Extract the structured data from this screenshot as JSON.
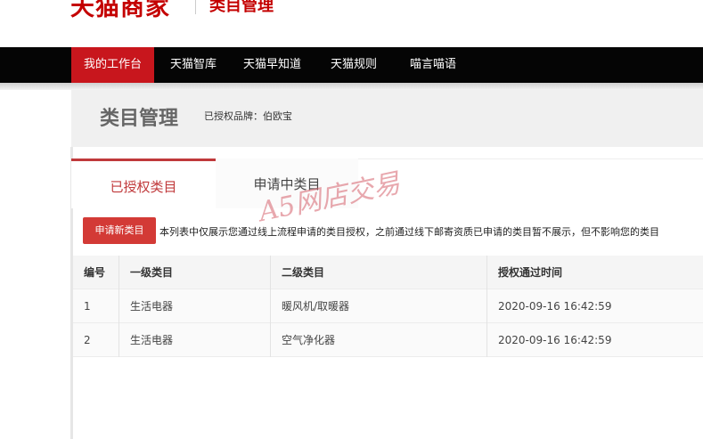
{
  "header": {
    "brand": "天猫商家",
    "subtitle": "类目管理"
  },
  "nav": {
    "items": [
      {
        "label": "我的工作台",
        "active": true
      },
      {
        "label": "天猫智库",
        "active": false
      },
      {
        "label": "天猫早知道",
        "active": false
      },
      {
        "label": "天猫规则",
        "active": false
      },
      {
        "label": "喵言喵语",
        "active": false
      }
    ]
  },
  "page": {
    "title": "类目管理",
    "brand_auth": "已授权品牌：伯欧宝"
  },
  "tabs": [
    {
      "label": "已授权类目",
      "active": true
    },
    {
      "label": "申请中类目",
      "active": false
    }
  ],
  "actions": {
    "apply_label": "申请新类目",
    "notice": "本列表中仅展示您通过线上流程申请的类目授权，之前通过线下邮寄资质已申请的类目暂不展示，但不影响您的类目"
  },
  "table": {
    "headers": [
      "编号",
      "一级类目",
      "二级类目",
      "授权通过时间"
    ],
    "rows": [
      [
        "1",
        "生活电器",
        "暖风机/取暖器",
        "2020-09-16 16:42:59"
      ],
      [
        "2",
        "生活电器",
        "空气净化器",
        "2020-09-16 16:42:59"
      ]
    ]
  },
  "watermark": "A5网店交易",
  "colors": {
    "brand_red": "#c40000",
    "nav_bg": "#050505",
    "nav_active": "#c8161d",
    "tab_active": "#c0393b",
    "button_bg": "#d33a36"
  }
}
